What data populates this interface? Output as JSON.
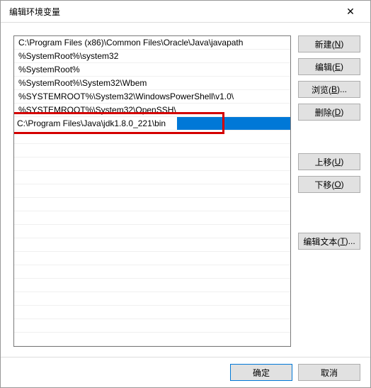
{
  "title": "编辑环境变量",
  "entries": [
    "C:\\Program Files (x86)\\Common Files\\Oracle\\Java\\javapath",
    "%SystemRoot%\\system32",
    "%SystemRoot%",
    "%SystemRoot%\\System32\\Wbem",
    "%SYSTEMROOT%\\System32\\WindowsPowerShell\\v1.0\\",
    "%SYSTEMROOT%\\System32\\OpenSSH\\",
    "C:\\Program Files\\Java\\jdk1.8.0_221\\bin"
  ],
  "selected_index": 6,
  "editing_index": 6,
  "buttons": {
    "new": {
      "label": "新建(",
      "hotkey": "N",
      "suffix": ")"
    },
    "edit": {
      "label": "编辑(",
      "hotkey": "E",
      "suffix": ")"
    },
    "browse": {
      "label": "浏览(",
      "hotkey": "B",
      "suffix": ")..."
    },
    "delete": {
      "label": "删除(",
      "hotkey": "D",
      "suffix": ")"
    },
    "up": {
      "label": "上移(",
      "hotkey": "U",
      "suffix": ")"
    },
    "down": {
      "label": "下移(",
      "hotkey": "O",
      "suffix": ")"
    },
    "edit_text": {
      "label": "编辑文本(",
      "hotkey": "T",
      "suffix": ")..."
    },
    "ok": "确定",
    "cancel": "取消"
  }
}
